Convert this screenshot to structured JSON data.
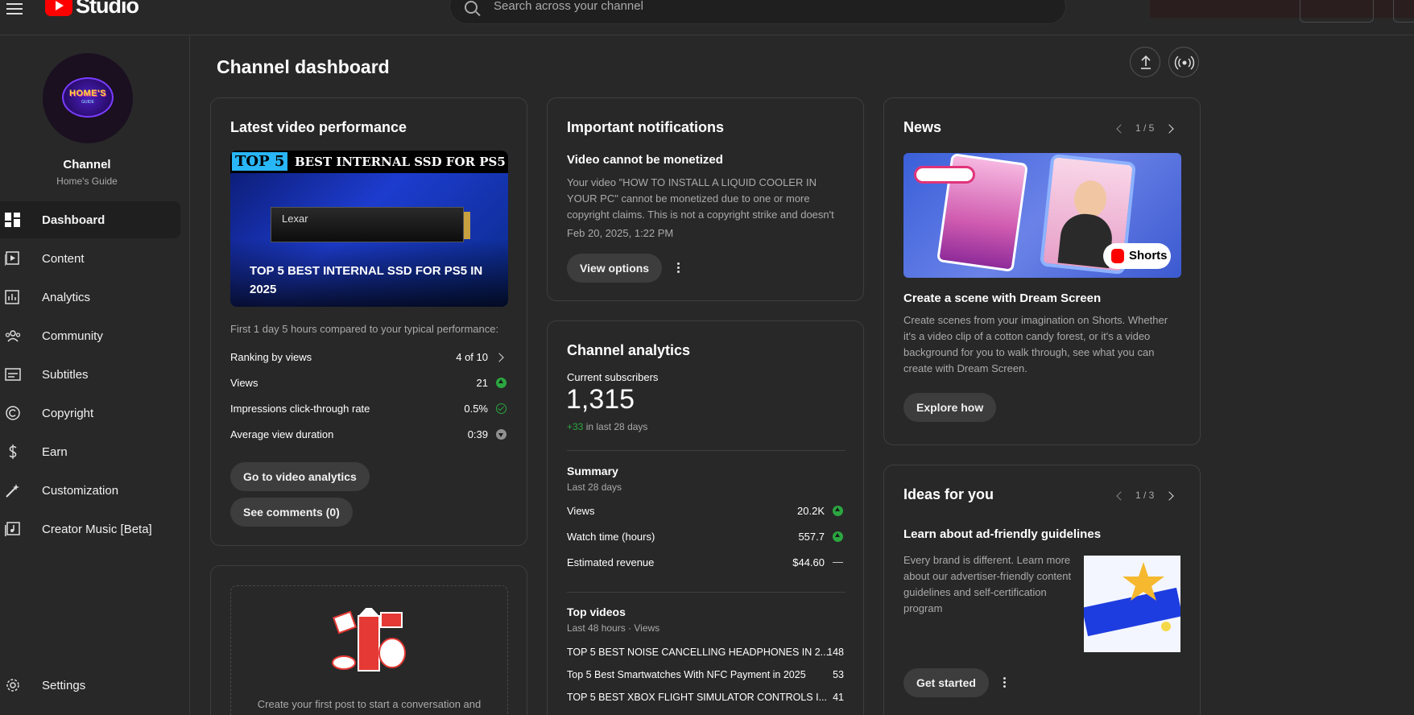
{
  "header": {
    "logo_text": "Studio",
    "search_placeholder": "Search across your channel"
  },
  "sidebar": {
    "avatar_text": "HOME'S",
    "avatar_subtext": "GUIDE",
    "channel_label": "Channel",
    "channel_name": "Home's Guide",
    "items": [
      {
        "label": "Dashboard",
        "icon": "dashboard-icon"
      },
      {
        "label": "Content",
        "icon": "content-icon"
      },
      {
        "label": "Analytics",
        "icon": "analytics-icon"
      },
      {
        "label": "Community",
        "icon": "community-icon"
      },
      {
        "label": "Subtitles",
        "icon": "subtitles-icon"
      },
      {
        "label": "Copyright",
        "icon": "copyright-icon"
      },
      {
        "label": "Earn",
        "icon": "earn-icon"
      },
      {
        "label": "Customization",
        "icon": "customization-icon"
      },
      {
        "label": "Creator Music [Beta]",
        "icon": "creator-music-icon"
      }
    ],
    "settings_label": "Settings"
  },
  "main": {
    "title": "Channel dashboard",
    "latest": {
      "title": "Latest video performance",
      "thumb_badge": "TOP 5",
      "thumb_banner": "BEST INTERNAL SSD FOR PS5",
      "thumb_brand": "Lexar",
      "video_title": "TOP 5 BEST INTERNAL SSD FOR PS5 IN 2025",
      "compare_text": "First 1 day 5 hours compared to your typical performance:",
      "ranking_label": "Ranking by views",
      "ranking_value": "4 of 10",
      "views_label": "Views",
      "views_value": "21",
      "ctr_label": "Impressions click-through rate",
      "ctr_value": "0.5%",
      "avd_label": "Average view duration",
      "avd_value": "0:39",
      "analytics_button": "Go to video analytics",
      "comments_button": "See comments (0)"
    },
    "post": {
      "text": "Create your first post to start a conversation and"
    },
    "notifications": {
      "title": "Important notifications",
      "heading": "Video cannot be monetized",
      "body": "Your video \"HOW TO INSTALL A LIQUID COOLER IN YOUR PC\" cannot be monetized due to one or more copyright claims. This is not a copyright strike and doesn't affect yo...",
      "date": "Feb 20, 2025, 1:22 PM",
      "button": "View options"
    },
    "analytics": {
      "title": "Channel analytics",
      "subs_label": "Current subscribers",
      "subs_value": "1,315",
      "subs_delta": "+33",
      "subs_delta_text": "in last 28 days",
      "summary_title": "Summary",
      "summary_period": "Last 28 days",
      "views_label": "Views",
      "views_value": "20.2K",
      "watch_label": "Watch time (hours)",
      "watch_value": "557.7",
      "revenue_label": "Estimated revenue",
      "revenue_value": "$44.60",
      "revenue_trend": "—",
      "top_title": "Top videos",
      "top_period": "Last 48 hours · Views",
      "top_videos": [
        {
          "title": "TOP 5 BEST NOISE CANCELLING HEADPHONES IN 2...",
          "views": "148"
        },
        {
          "title": "Top 5 Best Smartwatches With NFC Payment in 2025",
          "views": "53"
        },
        {
          "title": "TOP 5 BEST XBOX FLIGHT SIMULATOR CONTROLS I...",
          "views": "41"
        }
      ]
    },
    "news": {
      "title": "News",
      "pager": "1 / 5",
      "shorts_label": "Shorts",
      "heading": "Create a scene with Dream Screen",
      "body": "Create scenes from your imagination on Shorts. Whether it's a video clip of a cotton candy forest, or it's a video background for you to walk through, see what you can create with Dream Screen.",
      "button": "Explore how"
    },
    "ideas": {
      "title": "Ideas for you",
      "pager": "1 / 3",
      "heading": "Learn about ad-friendly guidelines",
      "body": "Every brand is different. Learn more about our advertiser-friendly content guidelines and self-certification program",
      "button": "Get started"
    }
  },
  "colors": {
    "background": "#282828",
    "accent_red": "#ff0000",
    "positive_green": "#2ba640"
  }
}
